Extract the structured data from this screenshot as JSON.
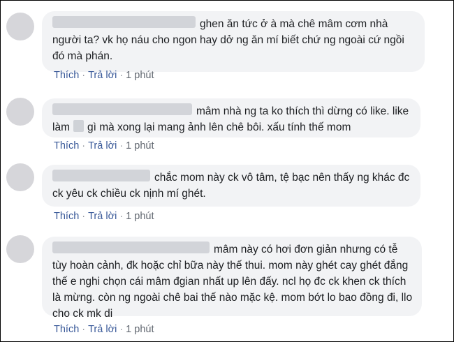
{
  "comments": [
    {
      "text": "ghen ăn tức ở à mà chê mâm cơm nhà người ta? vk họ náu cho ngon hay dở ng ăn mí biết chứ ng ngoài cứ ngồi đó mà phán.",
      "like": "Thích",
      "reply": "Trả lời",
      "time": "1 phút"
    },
    {
      "text_before": "mâm nhà ng ta ko thích thì dừng có like. like làm",
      "text_after": "gì mà xong lại mang ảnh lên chê bôi. xấu tính thế mom",
      "like": "Thích",
      "reply": "Trả lời",
      "time": "1 phút"
    },
    {
      "text": "chắc mom này ck vô tâm, tệ bạc nên thấy ng khác đc ck yêu ck chiều ck nịnh mí ghét.",
      "like": "Thích",
      "reply": "Trả lời",
      "time": "1 phút"
    },
    {
      "text": "mâm này có hơi đơn giản nhưng có tễ tùy hoàn cảnh, đk hoặc chỉ bữa này thế thui. mom này ghét cay ghét đắng thế e nghi chọn cái mâm đgian nhất up lên đấy. ncl họ đc ck khen ck thích là mừng. còn ng ngoài chê bai thế nào mặc kệ. mom bớt lo bao đồng đi, llo cho ck mk di",
      "like": "Thích",
      "reply": "Trả lời",
      "time": "1 phút"
    }
  ]
}
